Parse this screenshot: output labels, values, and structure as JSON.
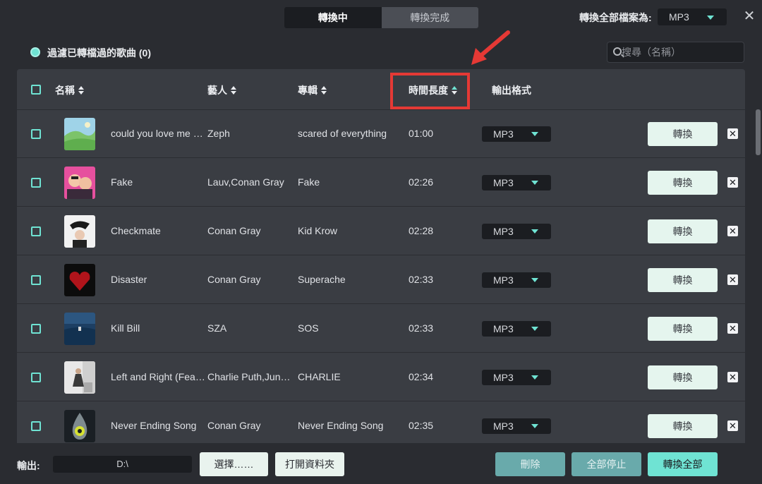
{
  "tabs": [
    {
      "label": "轉換中",
      "active": true
    },
    {
      "label": "轉換完成",
      "active": false
    }
  ],
  "header": {
    "convert_all_label": "轉換全部檔案為:",
    "convert_all_format": "MP3",
    "close_icon": "close-icon"
  },
  "filter": {
    "label": "過濾已轉檔過的歌曲 (0)",
    "checked": true
  },
  "search": {
    "placeholder": "搜尋（名稱）",
    "icon": "search-icon"
  },
  "columns": {
    "title": "名稱",
    "artist": "藝人",
    "album": "專輯",
    "duration": "時間長度",
    "format": "輸出格式"
  },
  "rows": [
    {
      "title": "could you love me …",
      "artist": "Zeph",
      "album": "scared of everything",
      "duration": "01:00",
      "format": "MP3",
      "convert": "轉換"
    },
    {
      "title": "Fake",
      "artist": "Lauv,Conan Gray",
      "album": "Fake",
      "duration": "02:26",
      "format": "MP3",
      "convert": "轉換"
    },
    {
      "title": "Checkmate",
      "artist": "Conan Gray",
      "album": "Kid Krow",
      "duration": "02:28",
      "format": "MP3",
      "convert": "轉換"
    },
    {
      "title": "Disaster",
      "artist": "Conan Gray",
      "album": "Superache",
      "duration": "02:33",
      "format": "MP3",
      "convert": "轉換"
    },
    {
      "title": "Kill Bill",
      "artist": "SZA",
      "album": "SOS",
      "duration": "02:33",
      "format": "MP3",
      "convert": "轉換"
    },
    {
      "title": "Left and Right (Fea…",
      "artist": "Charlie Puth,Jun…",
      "album": "CHARLIE",
      "duration": "02:34",
      "format": "MP3",
      "convert": "轉換"
    },
    {
      "title": "Never Ending Song",
      "artist": "Conan Gray",
      "album": "Never Ending Song",
      "duration": "02:35",
      "format": "MP3",
      "convert": "轉換"
    }
  ],
  "bottom": {
    "output_label": "輸出:",
    "output_path": "D:\\",
    "choose_button": "選擇……",
    "open_folder_button": "打開資料夾",
    "delete_button": "刪除",
    "stop_all_button": "全部停止",
    "convert_all_button": "轉換全部"
  },
  "colors": {
    "accent": "#6fe3d3",
    "highlight": "#e53935",
    "background": "#2a2c31",
    "table": "#3a3d43"
  }
}
